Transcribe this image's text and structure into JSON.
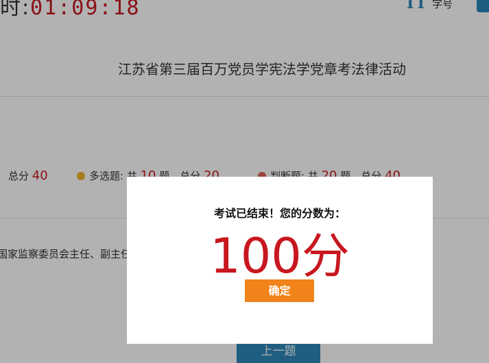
{
  "header": {
    "timer_prefix": "时:",
    "timer_value": "01:09:18",
    "fontsize_icon": "TT",
    "fontsize_label": "字号",
    "title": "江苏省第三届百万党员学宪法学党章考法律活动"
  },
  "stats": {
    "total_label": "总分",
    "total_value": "40",
    "multi_label": "多选题: 共",
    "multi_count": "10",
    "multi_mid": "题，总分",
    "multi_score": "20",
    "judge_label": "判断题: 共",
    "judge_count": "20",
    "judge_mid": "题，总分",
    "judge_score": "40"
  },
  "question": {
    "text": "国家监察委员会主任、副主任"
  },
  "nav": {
    "prev_label": "上一题"
  },
  "modal": {
    "title": "考试已结束！您的分数为：",
    "score": "100分",
    "confirm_label": "确定"
  },
  "colors": {
    "accent_red": "#c8171f",
    "accent_blue": "#2d87b8",
    "confirm_orange": "#f08319",
    "dot_yellow": "#f0b429",
    "dot_red": "#e0605a"
  },
  "icons": {
    "fontsize": "text-size-icon",
    "share": "share-icon"
  }
}
